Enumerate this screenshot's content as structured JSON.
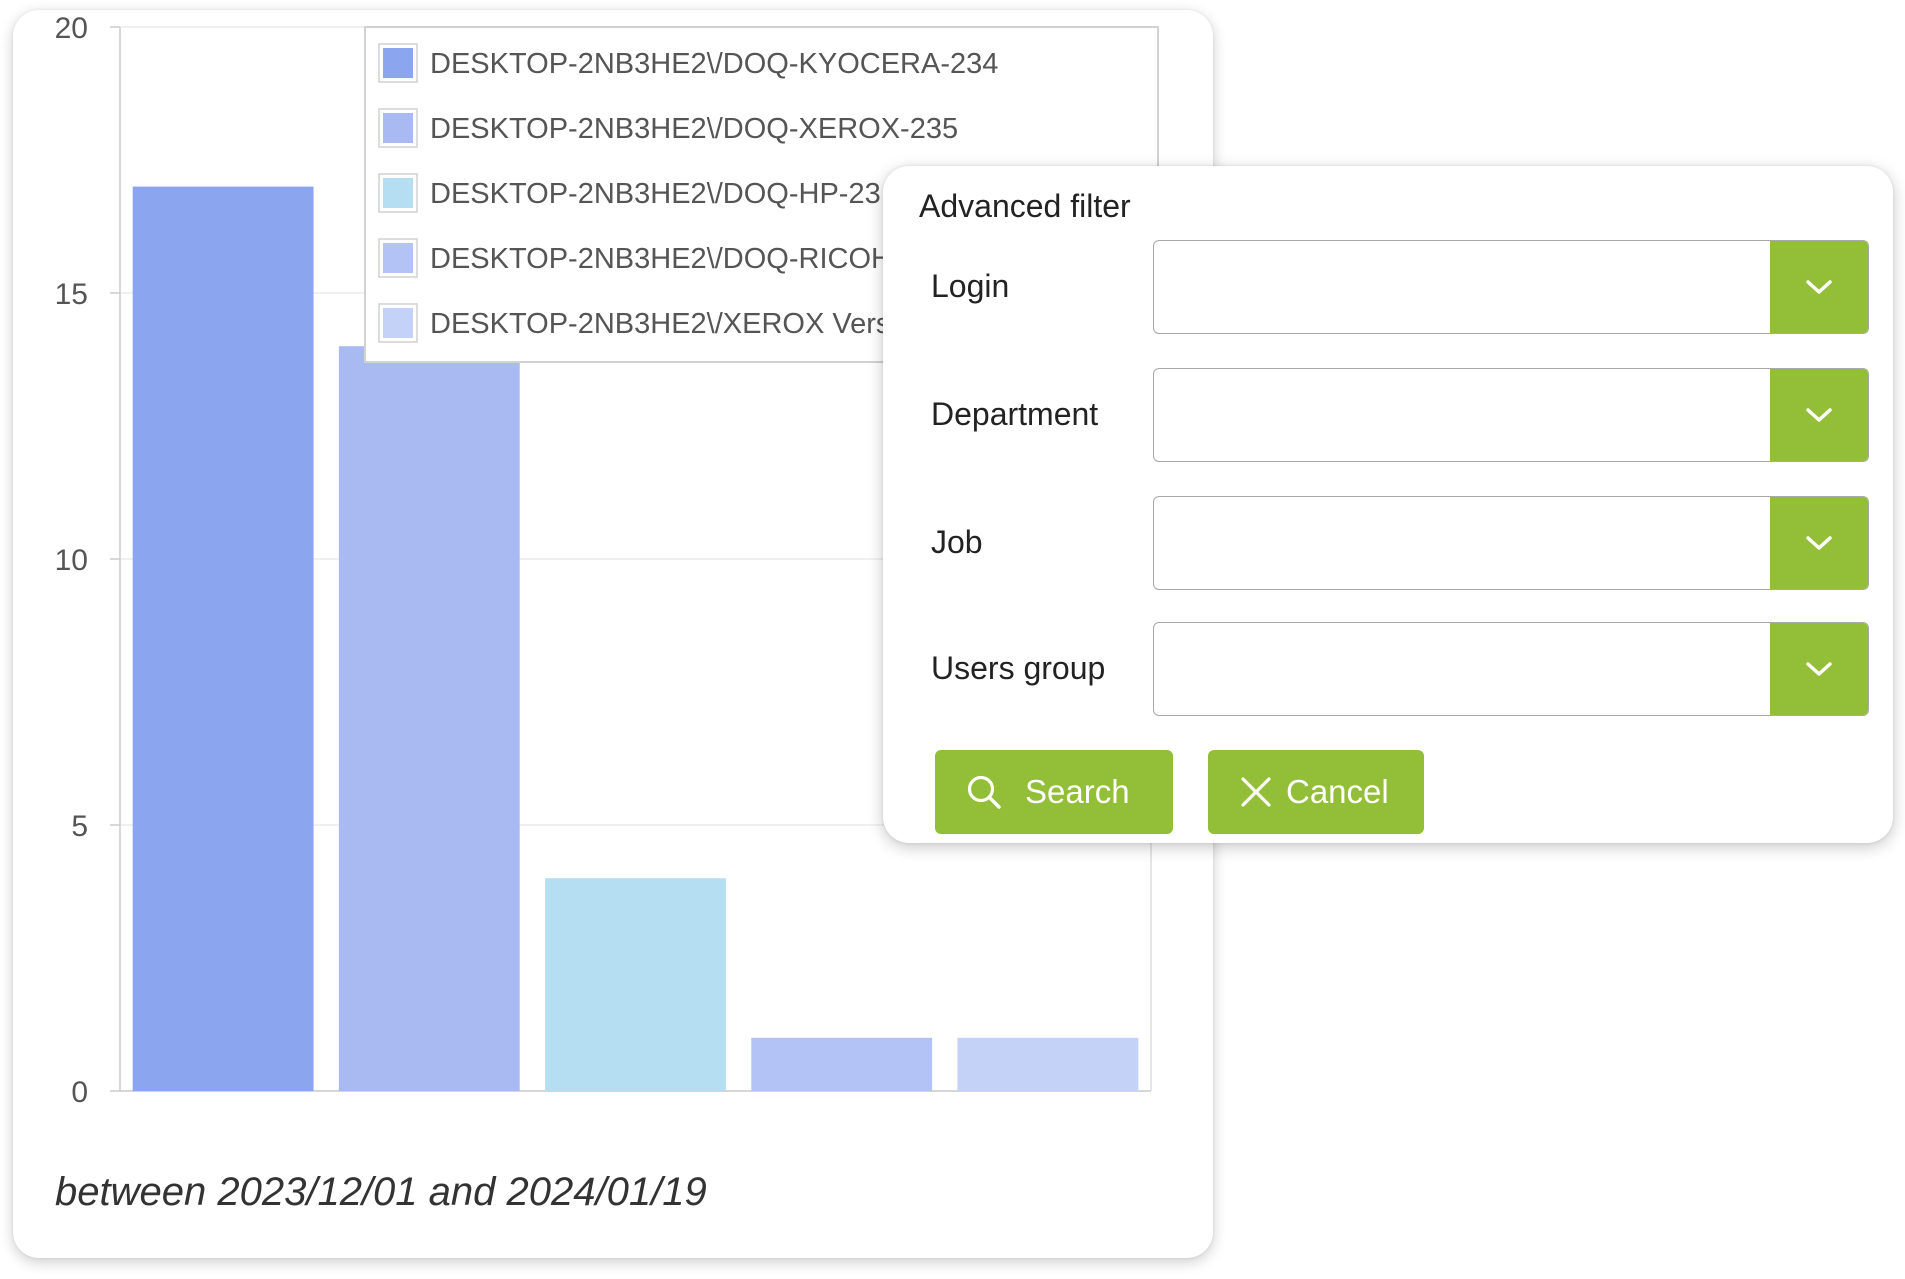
{
  "chart_data": {
    "type": "bar",
    "categories": [
      "DESKTOP-2NB3HE2\\/DOQ-KYOCERA-234",
      "DESKTOP-2NB3HE2\\/DOQ-XEROX-235",
      "DESKTOP-2NB3HE2\\/DOQ-HP-23",
      "DESKTOP-2NB3HE2\\/DOQ-RICOH",
      "DESKTOP-2NB3HE2\\/XEROX Vers"
    ],
    "values": [
      17,
      14,
      4,
      1,
      1
    ],
    "colors": [
      "#8ba5ee",
      "#a9baf3",
      "#b5def2",
      "#b4c3f5",
      "#c5d2f7"
    ],
    "yticks": [
      0,
      5,
      10,
      15,
      20
    ],
    "ylim": [
      0,
      20
    ],
    "grid": true,
    "legend_position": "top"
  },
  "date_range": "between 2023/12/01 and 2024/01/19",
  "filter": {
    "title": "Advanced filter",
    "fields": [
      {
        "label": "Login",
        "value": ""
      },
      {
        "label": "Department",
        "value": ""
      },
      {
        "label": "Job",
        "value": ""
      },
      {
        "label": "Users group",
        "value": ""
      }
    ],
    "search_label": "Search",
    "cancel_label": "Cancel",
    "accent_color": "#93be37",
    "dropdown_icon": "chevron-down-icon",
    "search_icon": "search-icon",
    "cancel_icon": "close-icon"
  }
}
